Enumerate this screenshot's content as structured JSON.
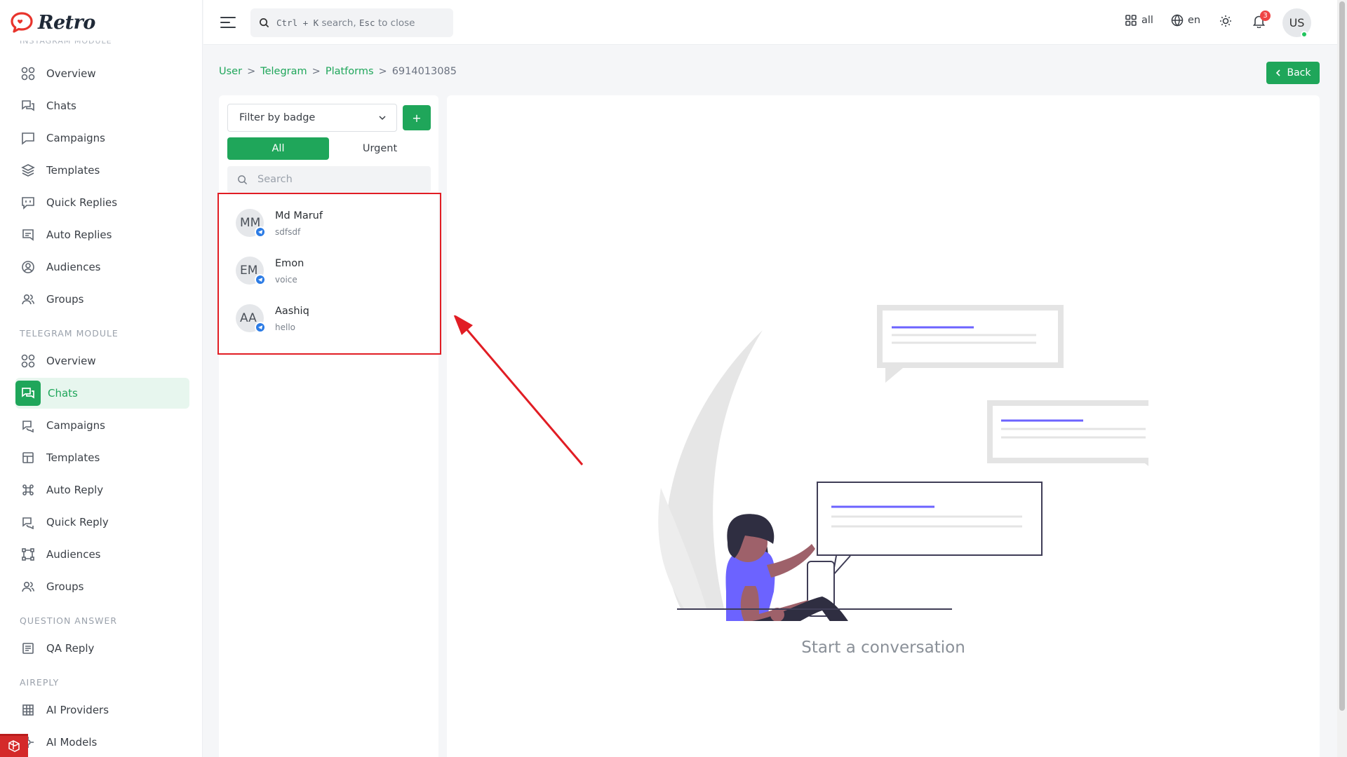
{
  "app": {
    "name": "Retro"
  },
  "sidebar": {
    "cut_section": "INSTAGRAM MODULE",
    "instagram_items": [
      {
        "label": "Overview",
        "icon": "grid-circles-icon"
      },
      {
        "label": "Chats",
        "icon": "chat-icon"
      },
      {
        "label": "Campaigns",
        "icon": "message-square-icon"
      },
      {
        "label": "Templates",
        "icon": "layers-icon"
      },
      {
        "label": "Quick Replies",
        "icon": "quick-reply-icon"
      },
      {
        "label": "Auto Replies",
        "icon": "auto-reply-icon"
      },
      {
        "label": "Audiences",
        "icon": "user-circle-icon"
      },
      {
        "label": "Groups",
        "icon": "users-icon"
      }
    ],
    "telegram_section": "TELEGRAM MODULE",
    "telegram_items": [
      {
        "label": "Overview",
        "icon": "grid-circles-icon"
      },
      {
        "label": "Chats",
        "icon": "chat-icon",
        "active": true
      },
      {
        "label": "Campaigns",
        "icon": "campaign-icon"
      },
      {
        "label": "Templates",
        "icon": "layout-icon"
      },
      {
        "label": "Auto Reply",
        "icon": "command-icon"
      },
      {
        "label": "Quick Reply",
        "icon": "quick-reply-icon"
      },
      {
        "label": "Audiences",
        "icon": "nodes-icon"
      },
      {
        "label": "Groups",
        "icon": "users-icon"
      }
    ],
    "qa_section": "QUESTION ANSWER",
    "qa_items": [
      {
        "label": "QA Reply",
        "icon": "list-icon"
      }
    ],
    "aireply_section": "AIREPLY",
    "ai_items": [
      {
        "label": "AI Providers",
        "icon": "table-icon"
      },
      {
        "label": "AI Models",
        "icon": "model-icon"
      }
    ]
  },
  "topbar": {
    "search_key1": "Ctrl + K",
    "search_text1": "search,",
    "search_key2": "Esc",
    "search_text2": "to close",
    "workspace_label": "all",
    "language_label": "en",
    "notification_count": "3",
    "user_initials": "US"
  },
  "breadcrumb": {
    "items": [
      "User",
      "Telegram",
      "Platforms"
    ],
    "current": "6914013085",
    "separator": ">"
  },
  "back_button": {
    "label": "Back"
  },
  "chat_list": {
    "filter_placeholder": "Filter by badge",
    "add_label": "+",
    "tabs": [
      "All",
      "Urgent"
    ],
    "search_placeholder": "Search",
    "chats": [
      {
        "initials": "MM",
        "name": "Md Maruf",
        "preview": "sdfsdf"
      },
      {
        "initials": "EM",
        "name": "Emon",
        "preview": "voice"
      },
      {
        "initials": "AA",
        "name": "Aashiq",
        "preview": "hello"
      }
    ]
  },
  "conversation": {
    "empty_text": "Start a conversation"
  },
  "colors": {
    "accent": "#1fa65a",
    "annotation": "#e11d24",
    "illustration": "#6c63ff"
  }
}
